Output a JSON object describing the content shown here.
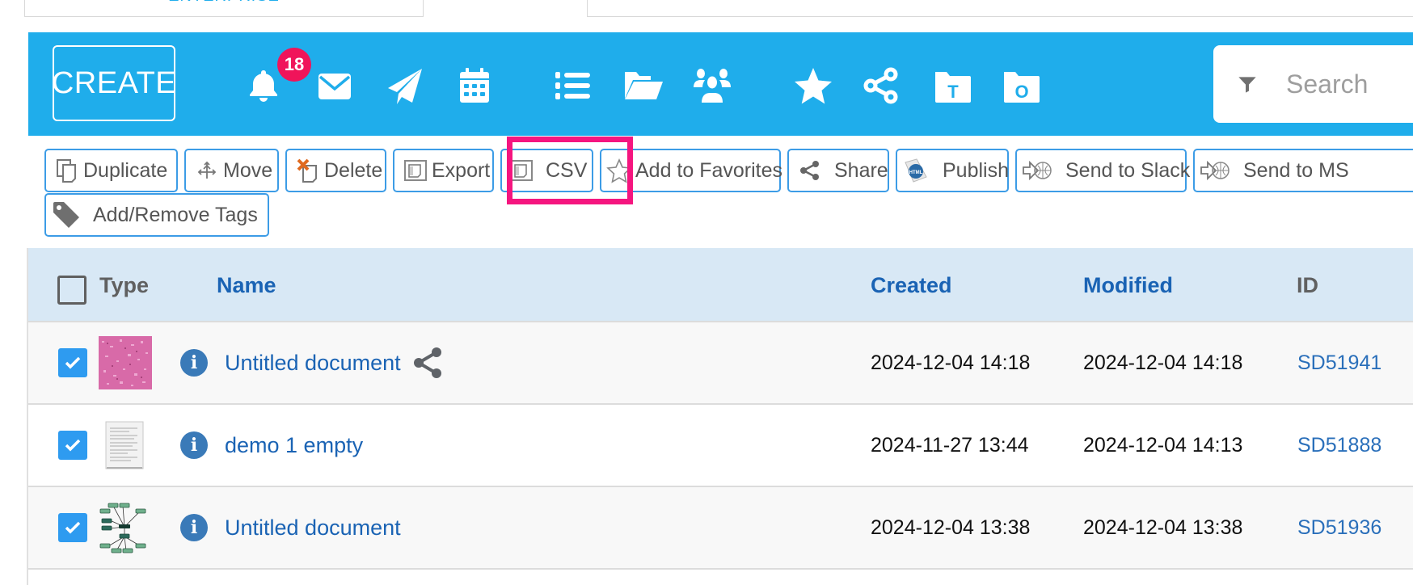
{
  "top_tabs": {
    "enterprise_label": "ENTERPRISE"
  },
  "toolbar": {
    "create_label": "CREATE",
    "notification_count": "18",
    "icons": [
      "bell-icon",
      "envelope-icon",
      "paper-plane-icon",
      "calendar-icon",
      "list-icon",
      "folder-open-icon",
      "users-icon",
      "star-icon",
      "share-nodes-icon",
      "template-folder-icon",
      "other-folder-icon"
    ],
    "template_folder_letter": "T",
    "other_folder_letter": "O",
    "search_placeholder": "Search",
    "brand_color": "#1fadeb"
  },
  "actions": {
    "buttons": [
      {
        "label": "Duplicate",
        "icon": "duplicate-icon"
      },
      {
        "label": "Move",
        "icon": "move-icon"
      },
      {
        "label": "Delete",
        "icon": "delete-icon"
      },
      {
        "label": "Export",
        "icon": "export-icon"
      },
      {
        "label": "CSV",
        "icon": "csv-icon"
      },
      {
        "label": "Add to Favorites",
        "icon": "star-outline-icon"
      },
      {
        "label": "Share",
        "icon": "share-icon"
      },
      {
        "label": "Publish",
        "icon": "html-publish-icon"
      },
      {
        "label": "Send to Slack",
        "icon": "send-globe-icon"
      },
      {
        "label": "Send to MS",
        "icon": "send-globe-icon"
      },
      {
        "label": "Add/Remove Tags",
        "icon": "tag-icon"
      }
    ],
    "highlighted": "CSV",
    "highlight_color": "#f5157f"
  },
  "table": {
    "columns": {
      "type": "Type",
      "name": "Name",
      "created": "Created",
      "modified": "Modified",
      "id": "ID"
    },
    "rows": [
      {
        "checked": true,
        "thumb": "pink-tissue-image",
        "name": "Untitled document",
        "shared": true,
        "created": "2024-12-04 14:18",
        "modified": "2024-12-04 14:18",
        "id": "SD51941"
      },
      {
        "checked": true,
        "thumb": "document-page-image",
        "name": "demo 1 empty",
        "shared": false,
        "created": "2024-11-27 13:44",
        "modified": "2024-12-04 14:13",
        "id": "SD51888"
      },
      {
        "checked": true,
        "thumb": "tree-diagram-image",
        "name": "Untitled document",
        "shared": false,
        "created": "2024-12-04 13:38",
        "modified": "2024-12-04 13:38",
        "id": "SD51936"
      }
    ]
  }
}
